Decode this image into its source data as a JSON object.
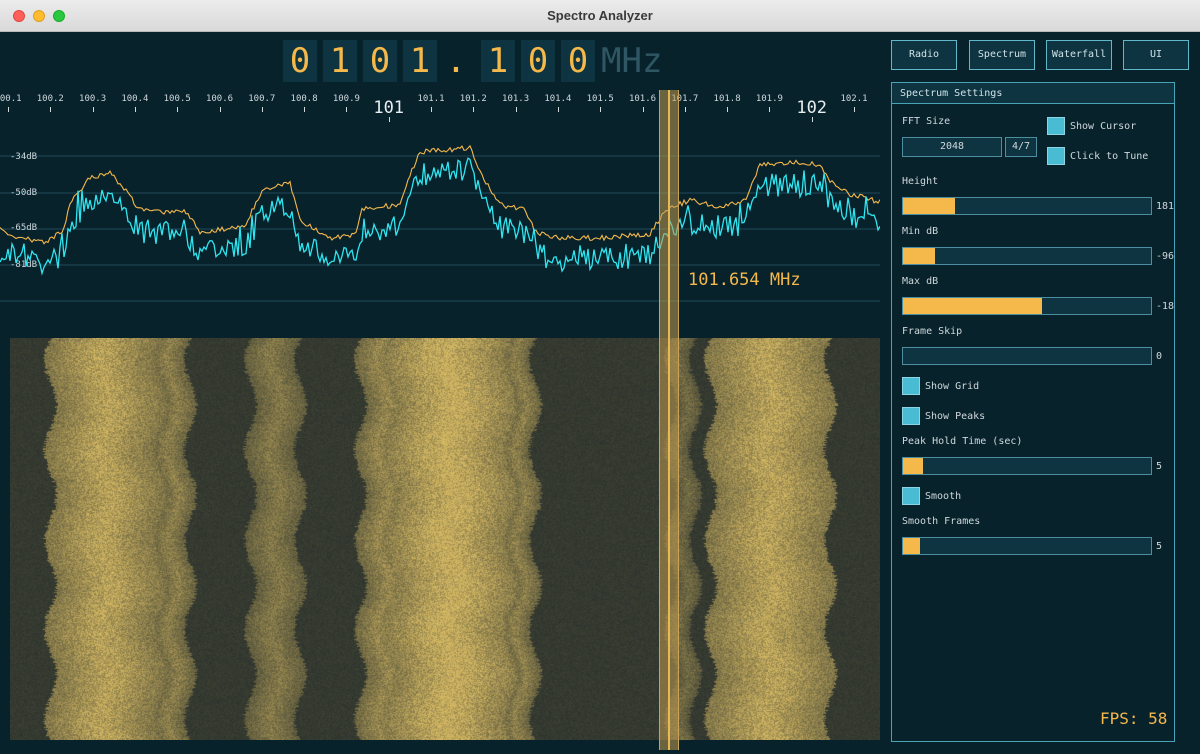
{
  "window": {
    "title": "Spectro Analyzer"
  },
  "frequency_display": {
    "digits": [
      "0",
      "1",
      "0",
      "1",
      ".",
      "1",
      "0",
      "0"
    ],
    "unit": "MHz"
  },
  "scale": {
    "ticks": [
      "100.1",
      "100.2",
      "100.3",
      "100.4",
      "100.5",
      "100.6",
      "100.7",
      "100.8",
      "100.9",
      "101",
      "101.1",
      "101.2",
      "101.3",
      "101.4",
      "101.5",
      "101.6",
      "101.7",
      "101.8",
      "101.9",
      "102",
      "102.1"
    ],
    "major": [
      "101",
      "102"
    ]
  },
  "spectrum": {
    "db_labels": [
      "-34dB",
      "-50dB",
      "-65dB",
      "-81dB"
    ]
  },
  "cursor": {
    "label": "101.654 MHz"
  },
  "tabs": [
    "Radio",
    "Spectrum",
    "Waterfall",
    "UI"
  ],
  "settings": {
    "heading": "Spectrum Settings",
    "fft_size_label": "FFT Size",
    "fft_size_value": "2048",
    "fft_size_index": "4/7",
    "show_cursor": "Show Cursor",
    "click_to_tune": "Click to Tune",
    "height": {
      "label": "Height",
      "value": "181",
      "fraction": 0.21
    },
    "min_db": {
      "label": "Min dB",
      "value": "-96",
      "fraction": 0.13
    },
    "max_db": {
      "label": "Max dB",
      "value": "-18",
      "fraction": 0.56
    },
    "frame_skip": {
      "label": "Frame Skip",
      "value": "0",
      "fraction": 0.0
    },
    "show_grid": "Show Grid",
    "show_peaks": "Show Peaks",
    "peak_hold": {
      "label": "Peak Hold Time (sec)",
      "value": "5",
      "fraction": 0.08
    },
    "smooth": "Smooth",
    "smooth_frames": {
      "label": "Smooth Frames",
      "value": "5",
      "fraction": 0.07
    }
  },
  "fps": "FPS: 58"
}
